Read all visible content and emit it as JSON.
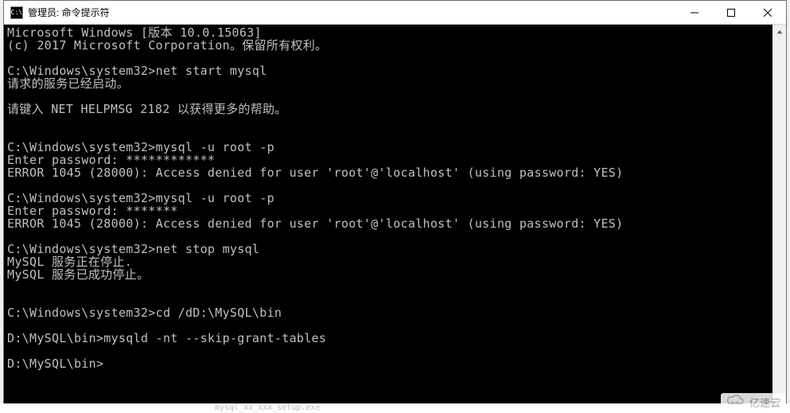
{
  "window": {
    "title": "管理员: 命令提示符",
    "icon_label": "C:\\"
  },
  "terminal": {
    "lines": [
      "Microsoft Windows [版本 10.0.15063]",
      "(c) 2017 Microsoft Corporation。保留所有权利。",
      "",
      "C:\\Windows\\system32>net start mysql",
      "请求的服务已经启动。",
      "",
      "请键入 NET HELPMSG 2182 以获得更多的帮助。",
      "",
      "",
      "C:\\Windows\\system32>mysql -u root -p",
      "Enter password: ************",
      "ERROR 1045 (28000): Access denied for user 'root'@'localhost' (using password: YES)",
      "",
      "C:\\Windows\\system32>mysql -u root -p",
      "Enter password: *******",
      "ERROR 1045 (28000): Access denied for user 'root'@'localhost' (using password: YES)",
      "",
      "C:\\Windows\\system32>net stop mysql",
      "MySQL 服务正在停止.",
      "MySQL 服务已成功停止。",
      "",
      "",
      "C:\\Windows\\system32>cd /dD:\\MySQL\\bin",
      "",
      "D:\\MySQL\\bin>mysqld -nt --skip-grant-tables",
      "",
      "D:\\MySQL\\bin>"
    ]
  },
  "watermark": {
    "text": "亿速云"
  },
  "faint_filename": "mysql_xx_xxx_setup.exe"
}
